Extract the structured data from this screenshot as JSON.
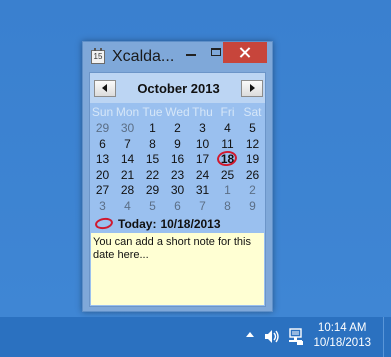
{
  "window": {
    "title": "Xcalda...",
    "icon": "calendar-icon",
    "controls": {
      "minimize": "minimize-icon",
      "maximize": "maximize-icon",
      "close": "close-icon"
    }
  },
  "calendar": {
    "month_label": "October 2013",
    "weekdays": [
      "Sun",
      "Mon",
      "Tue",
      "Wed",
      "Thu",
      "Fri",
      "Sat"
    ],
    "weeks": [
      [
        "29",
        "30",
        "1",
        "2",
        "3",
        "4",
        "5"
      ],
      [
        "6",
        "7",
        "8",
        "9",
        "10",
        "11",
        "12"
      ],
      [
        "13",
        "14",
        "15",
        "16",
        "17",
        "18",
        "19"
      ],
      [
        "20",
        "21",
        "22",
        "23",
        "24",
        "25",
        "26"
      ],
      [
        "27",
        "28",
        "29",
        "30",
        "31",
        "1",
        "2"
      ],
      [
        "3",
        "4",
        "5",
        "6",
        "7",
        "8",
        "9"
      ]
    ],
    "selected_day": "18",
    "today_label": "Today:",
    "today_value": "10/18/2013",
    "note_text": "You can add a short note for this date here...",
    "colors": {
      "accent": "#d0192f",
      "note_bg": "#ffffd3",
      "panel": "#9ac0ef"
    }
  },
  "taskbar": {
    "tray_icons": [
      "show-hidden-icons-icon",
      "speaker-icon",
      "network-icon"
    ],
    "clock_time": "10:14 AM",
    "clock_date": "10/18/2013"
  }
}
